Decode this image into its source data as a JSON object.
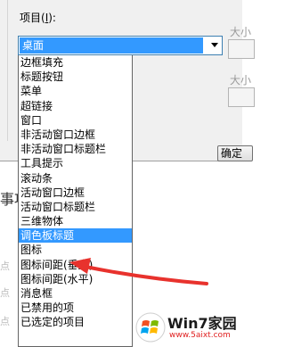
{
  "dialog": {
    "item_label_prefix": "项目(",
    "item_label_accel": "I",
    "item_label_suffix": "):",
    "right_field_label": "大小",
    "right_field_label_2": "大小",
    "ok_fragment": "确定",
    "side_char": "事项",
    "side_faint_1": "点",
    "side_faint_2": "点",
    "side_faint_3": "点"
  },
  "combo": {
    "value": "桌面"
  },
  "dropdown": {
    "items": [
      {
        "label": "边框填充"
      },
      {
        "label": "标题按钮"
      },
      {
        "label": "菜单"
      },
      {
        "label": "超链接"
      },
      {
        "label": "窗口"
      },
      {
        "label": "非活动窗口边框"
      },
      {
        "label": "非活动窗口标题栏"
      },
      {
        "label": "工具提示"
      },
      {
        "label": "滚动条"
      },
      {
        "label": "活动窗口边框"
      },
      {
        "label": "活动窗口标题栏"
      },
      {
        "label": "三维物体"
      },
      {
        "label": "调色板标题"
      },
      {
        "label": "图标"
      },
      {
        "label": "图标间距(垂直)"
      },
      {
        "label": "图标间距(水平)"
      },
      {
        "label": "消息框"
      },
      {
        "label": "已禁用的项"
      },
      {
        "label": "已选定的项目"
      }
    ],
    "selected_index": 12
  },
  "watermark": {
    "title": "Win7家园",
    "url": "www.5aixt.com"
  },
  "colors": {
    "selection": "#3399ff",
    "annotation_arrow": "#e8322d"
  }
}
